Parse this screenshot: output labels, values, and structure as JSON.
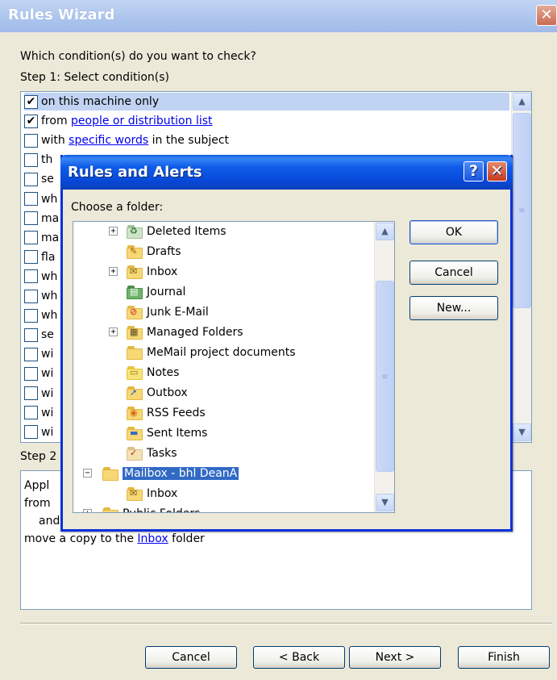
{
  "wizard": {
    "title": "Rules Wizard",
    "close_glyph": "✕",
    "question": "Which condition(s) do you want to check?",
    "step1_label": "Step 1: Select condition(s)",
    "conditions": [
      {
        "checked": true,
        "pre": "on this machine only",
        "link": "",
        "post": ""
      },
      {
        "checked": true,
        "pre": "from ",
        "link": "people or distribution list",
        "post": ""
      },
      {
        "checked": false,
        "pre": "with ",
        "link": "specific words",
        "post": " in the subject"
      },
      {
        "checked": false,
        "pre": "th",
        "link": "",
        "post": ""
      },
      {
        "checked": false,
        "pre": "se",
        "link": "",
        "post": ""
      },
      {
        "checked": false,
        "pre": "wh",
        "link": "",
        "post": ""
      },
      {
        "checked": false,
        "pre": "ma",
        "link": "",
        "post": ""
      },
      {
        "checked": false,
        "pre": "ma",
        "link": "",
        "post": ""
      },
      {
        "checked": false,
        "pre": "fla",
        "link": "",
        "post": ""
      },
      {
        "checked": false,
        "pre": "wh",
        "link": "",
        "post": ""
      },
      {
        "checked": false,
        "pre": "wh",
        "link": "",
        "post": ""
      },
      {
        "checked": false,
        "pre": "wh",
        "link": "",
        "post": ""
      },
      {
        "checked": false,
        "pre": "se",
        "link": "",
        "post": ""
      },
      {
        "checked": false,
        "pre": "wi",
        "link": "",
        "post": ""
      },
      {
        "checked": false,
        "pre": "wi",
        "link": "",
        "post": ""
      },
      {
        "checked": false,
        "pre": "wi",
        "link": "",
        "post": ""
      },
      {
        "checked": false,
        "pre": "wi",
        "link": "",
        "post": ""
      },
      {
        "checked": false,
        "pre": "wi",
        "link": "",
        "post": ""
      }
    ],
    "step2_label": "Step 2",
    "description": {
      "line1": "Appl",
      "line2": "from",
      "line3": "and",
      "line4_pre": "move a copy to the ",
      "line4_link": "Inbox",
      "line4_post": " folder"
    },
    "buttons": {
      "cancel": "Cancel",
      "back": "< Back",
      "next": "Next >",
      "finish": "Finish"
    }
  },
  "dialog": {
    "title": "Rules and Alerts",
    "help_glyph": "?",
    "close_glyph": "✕",
    "prompt": "Choose a folder:",
    "folders": [
      {
        "label": "Deleted Items",
        "expander": "+",
        "icon": "deleted-items-icon",
        "selected": false
      },
      {
        "label": "Drafts",
        "expander": "",
        "icon": "drafts-folder-icon",
        "selected": false
      },
      {
        "label": "Inbox",
        "expander": "+",
        "icon": "inbox-folder-icon",
        "selected": false
      },
      {
        "label": "Journal",
        "expander": "",
        "icon": "journal-icon",
        "selected": false
      },
      {
        "label": "Junk E-Mail",
        "expander": "",
        "icon": "junk-email-icon",
        "selected": false
      },
      {
        "label": "Managed Folders",
        "expander": "+",
        "icon": "managed-folders-icon",
        "selected": false
      },
      {
        "label": "MeMail project documents",
        "expander": "",
        "icon": "folder-icon",
        "selected": false
      },
      {
        "label": "Notes",
        "expander": "",
        "icon": "notes-icon",
        "selected": false
      },
      {
        "label": "Outbox",
        "expander": "",
        "icon": "outbox-icon",
        "selected": false
      },
      {
        "label": "RSS Feeds",
        "expander": "",
        "icon": "rss-feeds-icon",
        "selected": false
      },
      {
        "label": "Sent Items",
        "expander": "",
        "icon": "sent-items-icon",
        "selected": false
      },
      {
        "label": "Tasks",
        "expander": "",
        "icon": "tasks-icon",
        "selected": false
      },
      {
        "label": "Mailbox - bhl DeanA",
        "expander": "−",
        "icon": "mailbox-icon",
        "selected": true
      },
      {
        "label": "Inbox",
        "expander": "",
        "icon": "inbox-folder-icon",
        "selected": false
      },
      {
        "label": "Public Folders",
        "expander": "+",
        "icon": "public-folders-icon",
        "selected": false
      }
    ],
    "buttons": {
      "ok": "OK",
      "cancel": "Cancel",
      "new": "New..."
    }
  },
  "colors": {
    "xp_blue": "#0831d9",
    "selection": "#316ac5",
    "link": "#0000ee",
    "folder_yellow": "#f6d875"
  }
}
